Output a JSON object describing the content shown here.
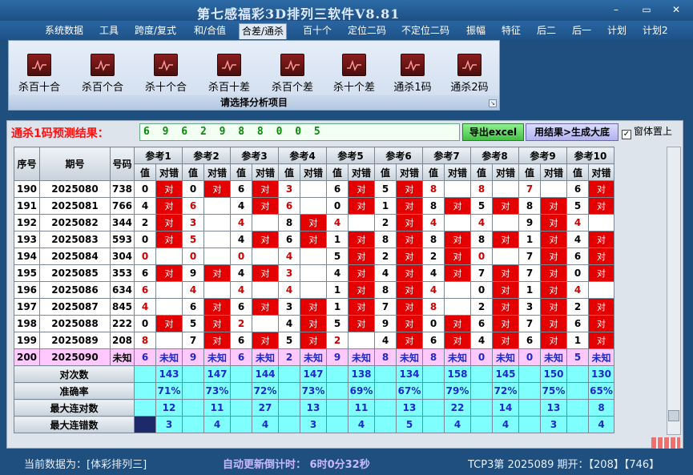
{
  "app": {
    "title": "第七感福彩3D排列三软件V8.81"
  },
  "window_controls": {
    "minimize": "–",
    "restore": "▭",
    "close": "✕"
  },
  "menu": [
    "系统数据",
    "工具",
    "跨度/复式",
    "和/合值",
    "合差/通杀",
    "百十个",
    "定位二码",
    "不定位二码",
    "振幅",
    "特征",
    "后二",
    "后一",
    "计划",
    "计划2"
  ],
  "ribbon": {
    "buttons": [
      "杀百十合",
      "杀百个合",
      "杀十个合",
      "杀百十差",
      "杀百个差",
      "杀十个差",
      "通杀1码",
      "通杀2码"
    ],
    "caption": "请选择分析项目"
  },
  "prediction": {
    "label": "通杀1码预测结果：",
    "value": "6 9 6 2 9 8 8 0 0 5"
  },
  "buttons": {
    "excel": "导出excel",
    "generate": "用结果>生成大底",
    "topmost": "窗体置上"
  },
  "table": {
    "headers": {
      "seq": "序号",
      "period": "期号",
      "number": "号码",
      "value": "值",
      "correct": "对错"
    },
    "refs": [
      "参考1",
      "参考2",
      "参考3",
      "参考4",
      "参考5",
      "参考6",
      "参考7",
      "参考8",
      "参考9",
      "参考10"
    ],
    "rows": [
      {
        "seq": "190",
        "period": "2025080",
        "number": "738",
        "cells": [
          [
            "0",
            "对"
          ],
          [
            "0",
            "对"
          ],
          [
            "6",
            "对"
          ],
          [
            "3",
            ""
          ],
          [
            "6",
            "对"
          ],
          [
            "5",
            "对"
          ],
          [
            "8",
            ""
          ],
          [
            "8",
            ""
          ],
          [
            "7",
            ""
          ],
          [
            "6",
            "对"
          ]
        ]
      },
      {
        "seq": "191",
        "period": "2025081",
        "number": "766",
        "cells": [
          [
            "4",
            "对"
          ],
          [
            "6",
            ""
          ],
          [
            "4",
            "对"
          ],
          [
            "6",
            ""
          ],
          [
            "0",
            "对"
          ],
          [
            "1",
            "对"
          ],
          [
            "8",
            "对"
          ],
          [
            "5",
            "对"
          ],
          [
            "8",
            "对"
          ],
          [
            "5",
            "对"
          ]
        ]
      },
      {
        "seq": "192",
        "period": "2025082",
        "number": "344",
        "cells": [
          [
            "2",
            "对"
          ],
          [
            "3",
            ""
          ],
          [
            "4",
            ""
          ],
          [
            "8",
            "对"
          ],
          [
            "4",
            ""
          ],
          [
            "2",
            "对"
          ],
          [
            "4",
            ""
          ],
          [
            "4",
            ""
          ],
          [
            "9",
            "对"
          ],
          [
            "4",
            ""
          ]
        ]
      },
      {
        "seq": "193",
        "period": "2025083",
        "number": "593",
        "cells": [
          [
            "0",
            "对"
          ],
          [
            "5",
            ""
          ],
          [
            "4",
            "对"
          ],
          [
            "6",
            "对"
          ],
          [
            "1",
            "对"
          ],
          [
            "8",
            "对"
          ],
          [
            "8",
            "对"
          ],
          [
            "8",
            "对"
          ],
          [
            "1",
            "对"
          ],
          [
            "4",
            "对"
          ]
        ]
      },
      {
        "seq": "194",
        "period": "2025084",
        "number": "304",
        "cells": [
          [
            "0",
            ""
          ],
          [
            "0",
            ""
          ],
          [
            "0",
            ""
          ],
          [
            "4",
            ""
          ],
          [
            "5",
            "对"
          ],
          [
            "2",
            "对"
          ],
          [
            "2",
            "对"
          ],
          [
            "0",
            ""
          ],
          [
            "7",
            "对"
          ],
          [
            "6",
            "对"
          ]
        ]
      },
      {
        "seq": "195",
        "period": "2025085",
        "number": "353",
        "cells": [
          [
            "6",
            "对"
          ],
          [
            "9",
            "对"
          ],
          [
            "4",
            "对"
          ],
          [
            "3",
            ""
          ],
          [
            "4",
            "对"
          ],
          [
            "4",
            "对"
          ],
          [
            "4",
            "对"
          ],
          [
            "7",
            "对"
          ],
          [
            "7",
            "对"
          ],
          [
            "0",
            "对"
          ]
        ]
      },
      {
        "seq": "196",
        "period": "2025086",
        "number": "634",
        "cells": [
          [
            "6",
            ""
          ],
          [
            "4",
            ""
          ],
          [
            "4",
            ""
          ],
          [
            "4",
            ""
          ],
          [
            "1",
            "对"
          ],
          [
            "8",
            "对"
          ],
          [
            "4",
            ""
          ],
          [
            "0",
            "对"
          ],
          [
            "1",
            "对"
          ],
          [
            "4",
            ""
          ]
        ]
      },
      {
        "seq": "197",
        "period": "2025087",
        "number": "845",
        "cells": [
          [
            "4",
            ""
          ],
          [
            "6",
            "对"
          ],
          [
            "6",
            "对"
          ],
          [
            "3",
            "对"
          ],
          [
            "1",
            "对"
          ],
          [
            "7",
            "对"
          ],
          [
            "8",
            ""
          ],
          [
            "2",
            "对"
          ],
          [
            "3",
            "对"
          ],
          [
            "2",
            "对"
          ]
        ]
      },
      {
        "seq": "198",
        "period": "2025088",
        "number": "222",
        "cells": [
          [
            "0",
            "对"
          ],
          [
            "5",
            "对"
          ],
          [
            "2",
            ""
          ],
          [
            "4",
            "对"
          ],
          [
            "5",
            "对"
          ],
          [
            "9",
            "对"
          ],
          [
            "0",
            "对"
          ],
          [
            "6",
            "对"
          ],
          [
            "7",
            "对"
          ],
          [
            "6",
            "对"
          ]
        ]
      },
      {
        "seq": "199",
        "period": "2025089",
        "number": "208",
        "cells": [
          [
            "8",
            ""
          ],
          [
            "7",
            "对"
          ],
          [
            "6",
            "对"
          ],
          [
            "5",
            "对"
          ],
          [
            "2",
            ""
          ],
          [
            "4",
            "对"
          ],
          [
            "6",
            "对"
          ],
          [
            "4",
            "对"
          ],
          [
            "6",
            "对"
          ],
          [
            "1",
            "对"
          ]
        ]
      }
    ],
    "future": {
      "seq": "200",
      "period": "2025090",
      "number": "未知",
      "values": [
        "6",
        "9",
        "6",
        "2",
        "9",
        "8",
        "8",
        "0",
        "0",
        "5"
      ],
      "unknown": "未知"
    },
    "stats": [
      {
        "label": "对次数",
        "values": [
          "143",
          "147",
          "144",
          "147",
          "138",
          "134",
          "158",
          "145",
          "150",
          "130"
        ]
      },
      {
        "label": "准确率",
        "values": [
          "71%",
          "73%",
          "72%",
          "73%",
          "69%",
          "67%",
          "79%",
          "72%",
          "75%",
          "65%"
        ]
      },
      {
        "label": "最大连对数",
        "values": [
          "12",
          "11",
          "27",
          "13",
          "11",
          "13",
          "22",
          "14",
          "13",
          "8"
        ]
      },
      {
        "label": "最大连错数",
        "values": [
          "3",
          "4",
          "4",
          "3",
          "4",
          "5",
          "4",
          "4",
          "3",
          "4"
        ]
      }
    ]
  },
  "statusbar": {
    "current": "当前数据为：[体彩排列三]",
    "countdown": "自动更新倒计时： 6时0分32秒",
    "latest": "TCP3第 2025089 期开：【208】【746】"
  },
  "colors": {
    "titlebar": "#1c4f82",
    "hit": "#e40000",
    "stat_bg": "#80ffff",
    "future_bg": "#ffc8ff",
    "countdown": "#c8b8ff"
  }
}
